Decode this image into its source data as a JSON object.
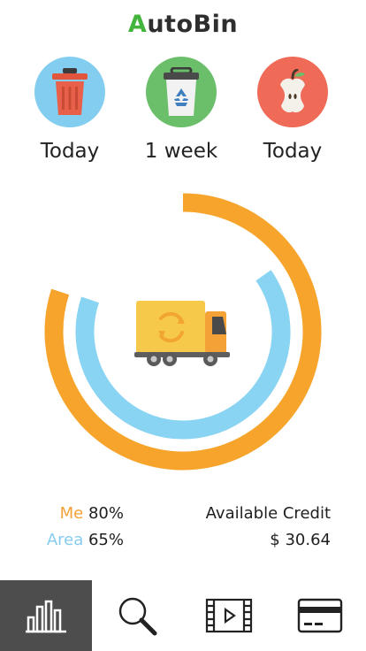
{
  "app": {
    "title_initial": "A",
    "title_rest": "utoBin"
  },
  "bins": [
    {
      "name": "trash",
      "label": "Today",
      "color": "#82cdf0",
      "icon": "trash-can-icon"
    },
    {
      "name": "recycle",
      "label": "1 week",
      "color": "#6bbf6b",
      "icon": "recycle-bin-icon"
    },
    {
      "name": "organic",
      "label": "Today",
      "color": "#ef6a57",
      "icon": "apple-core-icon"
    }
  ],
  "chart_data": {
    "type": "donut",
    "series": [
      {
        "name": "Me",
        "value": 80,
        "unit": "%",
        "color": "#f7a42c"
      },
      {
        "name": "Area",
        "value": 65,
        "unit": "%",
        "color": "#8ad4f3"
      }
    ],
    "center_icon": "garbage-truck-icon"
  },
  "stats": {
    "me_label": "Me",
    "me_value": "80%",
    "area_label": "Area",
    "area_value": "65%",
    "credit_label": "Available Credit",
    "credit_value": "$ 30.64"
  },
  "nav": [
    {
      "name": "stats",
      "icon": "bar-chart-icon",
      "active": true
    },
    {
      "name": "search",
      "icon": "search-icon",
      "active": false
    },
    {
      "name": "video",
      "icon": "video-icon",
      "active": false
    },
    {
      "name": "payment",
      "icon": "credit-card-icon",
      "active": false
    }
  ]
}
